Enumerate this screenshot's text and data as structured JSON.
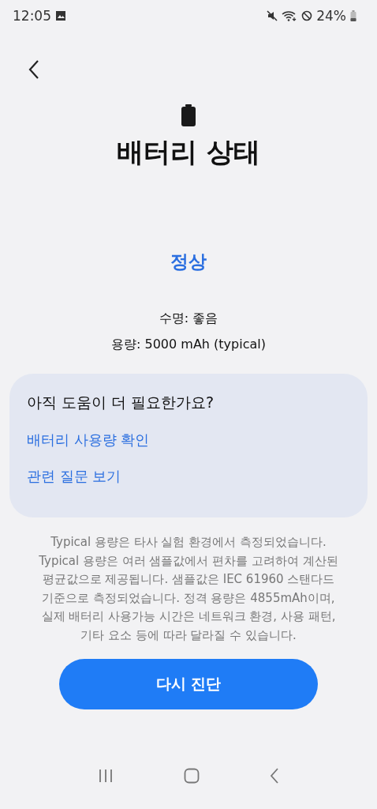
{
  "status_bar": {
    "time": "12:05",
    "battery": "24%"
  },
  "title": "배터리 상태",
  "status": "정상",
  "details": [
    "수명: 좋음",
    "용량: 5000 mAh (typical)"
  ],
  "help_card": {
    "title": "아직 도움이 더 필요한가요?",
    "links": [
      "배터리 사용량 확인",
      "관련 질문 보기"
    ]
  },
  "footnote": [
    "Typical 용량은 타사 실험 환경에서 측정되었습니다.",
    "Typical 용량은 여러 샘플값에서 편차를 고려하여 계산된",
    "평균값으로 제공됩니다. 샘플값은 IEC 61960 스탠다드",
    "기준으로 측정되었습니다. 정격 용량은 4855mAh이며,",
    "실제 배터리 사용가능 시간은 네트워크 환경, 사용 패턴,",
    "기타 요소 등에 따라 달라질 수 있습니다."
  ],
  "button": "다시 진단"
}
